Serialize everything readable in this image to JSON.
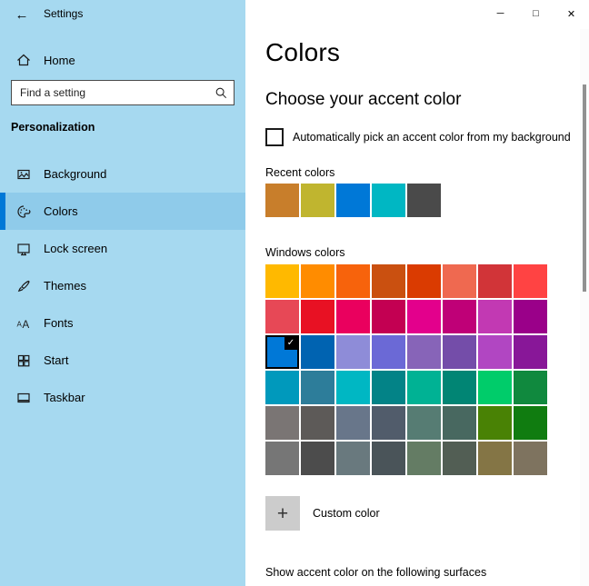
{
  "theme": {
    "accent": "#0078D7",
    "sidebar_bg": "#A6D9F0",
    "sidebar_selected_bg": "#8FCBEA",
    "custom_button_bg": "#CCCCCC",
    "scrollbar_thumb": "#919191"
  },
  "window": {
    "title": "Settings",
    "back_glyph": "←",
    "minimize_glyph": "─",
    "maximize_glyph": "□",
    "close_glyph": "✕"
  },
  "sidebar": {
    "home_label": "Home",
    "search_placeholder": "Find a setting",
    "section_heading": "Personalization",
    "items": [
      {
        "label": "Background",
        "icon": "background-icon",
        "selected": false
      },
      {
        "label": "Colors",
        "icon": "colors-icon",
        "selected": true
      },
      {
        "label": "Lock screen",
        "icon": "lock-screen-icon",
        "selected": false
      },
      {
        "label": "Themes",
        "icon": "themes-icon",
        "selected": false
      },
      {
        "label": "Fonts",
        "icon": "fonts-icon",
        "selected": false
      },
      {
        "label": "Start",
        "icon": "start-icon",
        "selected": false
      },
      {
        "label": "Taskbar",
        "icon": "taskbar-icon",
        "selected": false
      }
    ]
  },
  "main": {
    "page_title": "Colors",
    "section_title": "Choose your accent color",
    "auto_pick_label": "Automatically pick an accent color from my background",
    "auto_pick_checked": false,
    "recent_colors_label": "Recent colors",
    "recent_colors": [
      "#C87E2B",
      "#C0B52F",
      "#0078D7",
      "#00B7C3",
      "#4A4A4A"
    ],
    "windows_colors_label": "Windows colors",
    "windows_colors": [
      "#FFB900",
      "#FF8C00",
      "#F7630C",
      "#CA5010",
      "#DA3B01",
      "#EF6950",
      "#D13438",
      "#FF4343",
      "#E74856",
      "#E81123",
      "#EA005E",
      "#C30052",
      "#E3008C",
      "#BF0077",
      "#C239B3",
      "#9A0089",
      "#0078D7",
      "#0063B1",
      "#8E8CD8",
      "#6B69D6",
      "#8764B8",
      "#744DA9",
      "#B146C2",
      "#881798",
      "#0099BC",
      "#2D7D9A",
      "#00B7C3",
      "#038387",
      "#00B294",
      "#018574",
      "#00CC6A",
      "#10893E",
      "#7A7574",
      "#5D5A58",
      "#68768A",
      "#515C6B",
      "#567C73",
      "#486860",
      "#498205",
      "#107C10",
      "#767676",
      "#4C4C4C",
      "#69797E",
      "#4A5459",
      "#647C64",
      "#525E54",
      "#847545",
      "#7E735F"
    ],
    "selected_color_index": 16,
    "check_glyph": "✓",
    "custom_color": {
      "plus_glyph": "+",
      "label": "Custom color"
    },
    "footer_text": "Show accent color on the following surfaces"
  }
}
